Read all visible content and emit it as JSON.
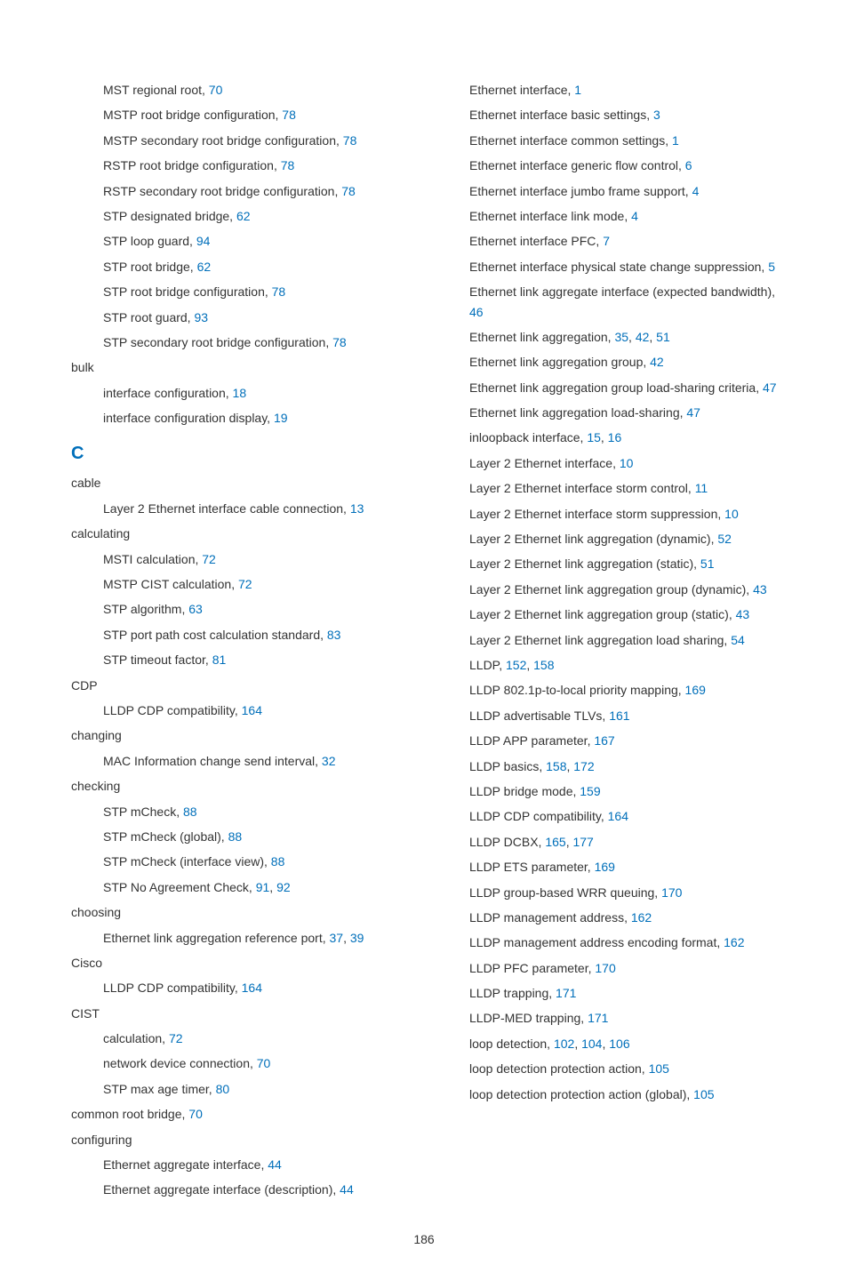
{
  "pageNumber": "186",
  "left": [
    {
      "level": 1,
      "text": "MST regional root, ",
      "pages": [
        "70"
      ]
    },
    {
      "level": 1,
      "text": "MSTP root bridge configuration, ",
      "pages": [
        "78"
      ]
    },
    {
      "level": 1,
      "text": "MSTP secondary root bridge configuration, ",
      "pages": [
        "78"
      ]
    },
    {
      "level": 1,
      "text": "RSTP root bridge configuration, ",
      "pages": [
        "78"
      ]
    },
    {
      "level": 1,
      "text": "RSTP secondary root bridge configuration, ",
      "pages": [
        "78"
      ]
    },
    {
      "level": 1,
      "text": "STP designated bridge, ",
      "pages": [
        "62"
      ]
    },
    {
      "level": 1,
      "text": "STP loop guard, ",
      "pages": [
        "94"
      ]
    },
    {
      "level": 1,
      "text": "STP root bridge, ",
      "pages": [
        "62"
      ]
    },
    {
      "level": 1,
      "text": "STP root bridge configuration, ",
      "pages": [
        "78"
      ]
    },
    {
      "level": 1,
      "text": "STP root guard, ",
      "pages": [
        "93"
      ]
    },
    {
      "level": 1,
      "text": "STP secondary root bridge configuration, ",
      "pages": [
        "78"
      ]
    },
    {
      "level": 0,
      "text": "bulk",
      "pages": []
    },
    {
      "level": 1,
      "text": "interface configuration, ",
      "pages": [
        "18"
      ]
    },
    {
      "level": 1,
      "text": "interface configuration display, ",
      "pages": [
        "19"
      ]
    },
    {
      "section": "C"
    },
    {
      "level": 0,
      "text": "cable",
      "pages": []
    },
    {
      "level": 1,
      "text": "Layer 2 Ethernet interface cable connection, ",
      "pages": [
        "13"
      ]
    },
    {
      "level": 0,
      "text": "calculating",
      "pages": []
    },
    {
      "level": 1,
      "text": "MSTI calculation, ",
      "pages": [
        "72"
      ]
    },
    {
      "level": 1,
      "text": "MSTP CIST calculation, ",
      "pages": [
        "72"
      ]
    },
    {
      "level": 1,
      "text": "STP algorithm, ",
      "pages": [
        "63"
      ]
    },
    {
      "level": 1,
      "text": "STP port path cost calculation standard, ",
      "pages": [
        "83"
      ]
    },
    {
      "level": 1,
      "text": "STP timeout factor, ",
      "pages": [
        "81"
      ]
    },
    {
      "level": 0,
      "text": "CDP",
      "pages": []
    },
    {
      "level": 1,
      "text": "LLDP CDP compatibility, ",
      "pages": [
        "164"
      ]
    },
    {
      "level": 0,
      "text": "changing",
      "pages": []
    },
    {
      "level": 1,
      "text": "MAC Information change send interval, ",
      "pages": [
        "32"
      ]
    },
    {
      "level": 0,
      "text": "checking",
      "pages": []
    },
    {
      "level": 1,
      "text": "STP mCheck, ",
      "pages": [
        "88"
      ]
    },
    {
      "level": 1,
      "text": "STP mCheck (global), ",
      "pages": [
        "88"
      ]
    },
    {
      "level": 1,
      "text": "STP mCheck (interface view), ",
      "pages": [
        "88"
      ]
    },
    {
      "level": 1,
      "text": "STP No Agreement Check, ",
      "pages": [
        "91",
        "92"
      ]
    },
    {
      "level": 0,
      "text": "choosing",
      "pages": []
    },
    {
      "level": 1,
      "text": "Ethernet link aggregation reference port, ",
      "pages": [
        "37",
        "39"
      ]
    },
    {
      "level": 0,
      "text": "Cisco",
      "pages": []
    },
    {
      "level": 1,
      "text": "LLDP CDP compatibility, ",
      "pages": [
        "164"
      ]
    },
    {
      "level": 0,
      "text": "CIST",
      "pages": []
    },
    {
      "level": 1,
      "text": "calculation, ",
      "pages": [
        "72"
      ]
    },
    {
      "level": 1,
      "text": "network device connection, ",
      "pages": [
        "70"
      ]
    },
    {
      "level": 1,
      "text": "STP max age timer, ",
      "pages": [
        "80"
      ]
    },
    {
      "level": 0,
      "text": "common root bridge, ",
      "pages": [
        "70"
      ]
    },
    {
      "level": 0,
      "text": "configuring",
      "pages": []
    },
    {
      "level": 1,
      "text": "Ethernet aggregate interface, ",
      "pages": [
        "44"
      ]
    },
    {
      "level": 1,
      "text": "Ethernet aggregate interface (description), ",
      "pages": [
        "44"
      ]
    }
  ],
  "right": [
    {
      "level": 1,
      "text": "Ethernet interface, ",
      "pages": [
        "1"
      ]
    },
    {
      "level": 1,
      "text": "Ethernet interface basic settings, ",
      "pages": [
        "3"
      ]
    },
    {
      "level": 1,
      "text": "Ethernet interface common settings, ",
      "pages": [
        "1"
      ]
    },
    {
      "level": 1,
      "text": "Ethernet interface generic flow control, ",
      "pages": [
        "6"
      ]
    },
    {
      "level": 1,
      "text": "Ethernet interface jumbo frame support, ",
      "pages": [
        "4"
      ]
    },
    {
      "level": 1,
      "text": "Ethernet interface link mode, ",
      "pages": [
        "4"
      ]
    },
    {
      "level": 1,
      "text": "Ethernet interface PFC, ",
      "pages": [
        "7"
      ]
    },
    {
      "level": 1,
      "text": "Ethernet interface physical state change suppression, ",
      "pages": [
        "5"
      ]
    },
    {
      "level": 1,
      "text": "Ethernet link aggregate interface (expected bandwidth), ",
      "pages": [
        "46"
      ]
    },
    {
      "level": 1,
      "text": "Ethernet link aggregation, ",
      "pages": [
        "35",
        "42",
        "51"
      ]
    },
    {
      "level": 1,
      "text": "Ethernet link aggregation group, ",
      "pages": [
        "42"
      ]
    },
    {
      "level": 1,
      "text": "Ethernet link aggregation group load-sharing criteria, ",
      "pages": [
        "47"
      ]
    },
    {
      "level": 1,
      "text": "Ethernet link aggregation load-sharing, ",
      "pages": [
        "47"
      ]
    },
    {
      "level": 1,
      "text": "inloopback interface, ",
      "pages": [
        "15",
        "16"
      ]
    },
    {
      "level": 1,
      "text": "Layer 2 Ethernet interface, ",
      "pages": [
        "10"
      ]
    },
    {
      "level": 1,
      "text": "Layer 2 Ethernet interface storm control, ",
      "pages": [
        "11"
      ]
    },
    {
      "level": 1,
      "text": "Layer 2 Ethernet interface storm suppression, ",
      "pages": [
        "10"
      ]
    },
    {
      "level": 1,
      "text": "Layer 2 Ethernet link aggregation (dynamic), ",
      "pages": [
        "52"
      ]
    },
    {
      "level": 1,
      "text": "Layer 2 Ethernet link aggregation (static), ",
      "pages": [
        "51"
      ]
    },
    {
      "level": 1,
      "text": "Layer 2 Ethernet link aggregation group (dynamic), ",
      "pages": [
        "43"
      ]
    },
    {
      "level": 1,
      "text": "Layer 2 Ethernet link aggregation group (static), ",
      "pages": [
        "43"
      ]
    },
    {
      "level": 1,
      "text": "Layer 2 Ethernet link aggregation load sharing, ",
      "pages": [
        "54"
      ]
    },
    {
      "level": 1,
      "text": "LLDP, ",
      "pages": [
        "152",
        "158"
      ]
    },
    {
      "level": 1,
      "text": "LLDP 802.1p-to-local priority mapping, ",
      "pages": [
        "169"
      ]
    },
    {
      "level": 1,
      "text": "LLDP advertisable TLVs, ",
      "pages": [
        "161"
      ]
    },
    {
      "level": 1,
      "text": "LLDP APP parameter, ",
      "pages": [
        "167"
      ]
    },
    {
      "level": 1,
      "text": "LLDP basics, ",
      "pages": [
        "158",
        "172"
      ]
    },
    {
      "level": 1,
      "text": "LLDP bridge mode, ",
      "pages": [
        "159"
      ]
    },
    {
      "level": 1,
      "text": "LLDP CDP compatibility, ",
      "pages": [
        "164"
      ]
    },
    {
      "level": 1,
      "text": "LLDP DCBX, ",
      "pages": [
        "165",
        "177"
      ]
    },
    {
      "level": 1,
      "text": "LLDP ETS parameter, ",
      "pages": [
        "169"
      ]
    },
    {
      "level": 1,
      "text": "LLDP group-based WRR queuing, ",
      "pages": [
        "170"
      ]
    },
    {
      "level": 1,
      "text": "LLDP management address, ",
      "pages": [
        "162"
      ]
    },
    {
      "level": 1,
      "text": "LLDP management address encoding format, ",
      "pages": [
        "162"
      ]
    },
    {
      "level": 1,
      "text": "LLDP PFC parameter, ",
      "pages": [
        "170"
      ]
    },
    {
      "level": 1,
      "text": "LLDP trapping, ",
      "pages": [
        "171"
      ]
    },
    {
      "level": 1,
      "text": "LLDP-MED trapping, ",
      "pages": [
        "171"
      ]
    },
    {
      "level": 1,
      "text": "loop detection, ",
      "pages": [
        "102",
        "104",
        "106"
      ]
    },
    {
      "level": 1,
      "text": "loop detection protection action, ",
      "pages": [
        "105"
      ]
    },
    {
      "level": 1,
      "text": "loop detection protection action (global), ",
      "pages": [
        "105"
      ]
    }
  ]
}
